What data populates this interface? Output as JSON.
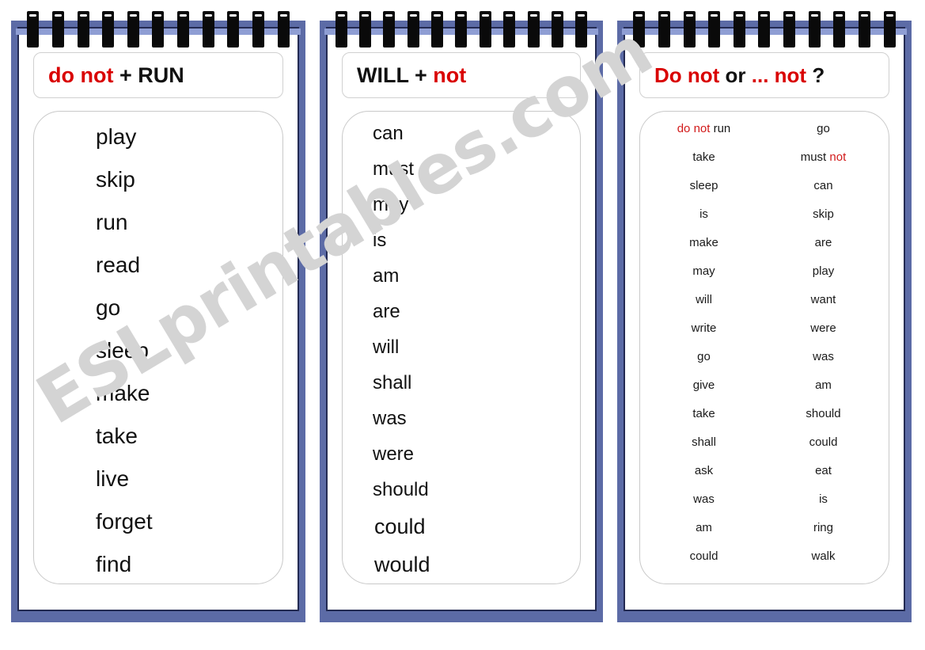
{
  "watermark": {
    "text": "ESLprintables.com",
    "color": "#d4d4d4"
  },
  "theme": {
    "frame_blue": "#5c6ba6",
    "frame_navy": "#232a52",
    "ring_bar_blue": "#8f9ed4",
    "red": "#d90000",
    "black": "#111111"
  },
  "cards": [
    {
      "id": "card-1",
      "header": {
        "red_part": "do not",
        "black_part": " + RUN"
      },
      "words": [
        "play",
        "skip",
        "run",
        "read",
        "go",
        "sleep",
        "make",
        "take",
        "live",
        "forget",
        "find"
      ]
    },
    {
      "id": "card-2",
      "header": {
        "black_part": "WILL + ",
        "red_part": "not"
      },
      "words": [
        "can",
        "must",
        "may",
        "is",
        "am",
        "are",
        "will",
        "shall",
        "was",
        "were",
        "should",
        "could",
        "would"
      ]
    },
    {
      "id": "card-3",
      "header": {
        "red_part_1": "Do not",
        "black_part_1": "  or  ",
        "red_part_2": "... not",
        "black_part_2": " ?"
      },
      "columns": {
        "left": [
          {
            "red": "do not ",
            "black": "run"
          },
          {
            "black": "take"
          },
          {
            "black": "sleep"
          },
          {
            "black": "is"
          },
          {
            "black": "make"
          },
          {
            "black": "may"
          },
          {
            "black": "will"
          },
          {
            "black": "write"
          },
          {
            "black": "go"
          },
          {
            "black": "give"
          },
          {
            "black": "take"
          },
          {
            "black": "shall"
          },
          {
            "black": "ask"
          },
          {
            "black": "was"
          },
          {
            "black": "am"
          },
          {
            "black": "could"
          }
        ],
        "right": [
          {
            "black": "go"
          },
          {
            "black": "must ",
            "red": " not"
          },
          {
            "black": "can"
          },
          {
            "black": "skip"
          },
          {
            "black": "are"
          },
          {
            "black": "play"
          },
          {
            "black": "want"
          },
          {
            "black": "were"
          },
          {
            "black": "was"
          },
          {
            "black": "am"
          },
          {
            "black": "should"
          },
          {
            "black": "could"
          },
          {
            "black": "eat"
          },
          {
            "black": "is"
          },
          {
            "black": "ring"
          },
          {
            "black": "walk"
          }
        ]
      }
    }
  ],
  "spiral": {
    "ring_count": 11
  }
}
